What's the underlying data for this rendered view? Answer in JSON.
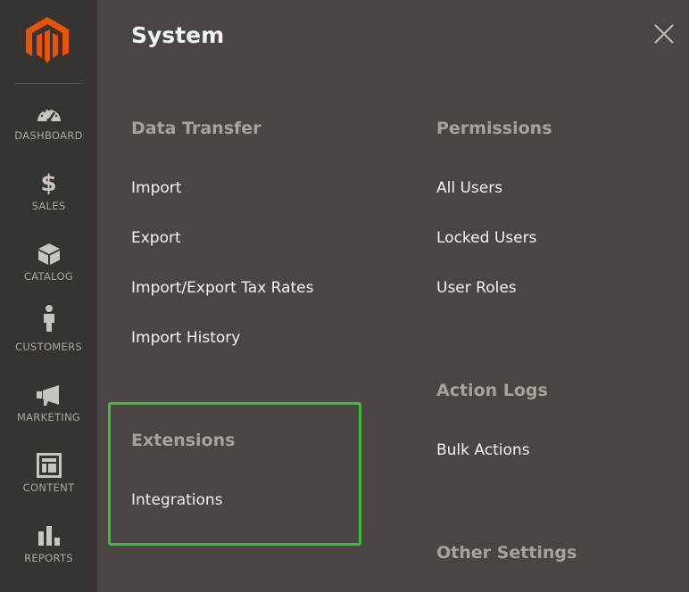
{
  "sidebar": {
    "logo": {
      "icon": "magento-logo-icon",
      "color": "#eb5202"
    },
    "items": [
      {
        "label": "DASHBOARD",
        "icon": "speedometer-icon"
      },
      {
        "label": "SALES",
        "icon": "dollar-icon"
      },
      {
        "label": "CATALOG",
        "icon": "box-icon"
      },
      {
        "label": "CUSTOMERS",
        "icon": "person-icon"
      },
      {
        "label": "MARKETING",
        "icon": "megaphone-icon"
      },
      {
        "label": "CONTENT",
        "icon": "layout-icon"
      },
      {
        "label": "REPORTS",
        "icon": "bar-chart-icon"
      }
    ]
  },
  "panel": {
    "title": "System",
    "close_icon": "close-icon",
    "groups": {
      "data_transfer": {
        "title": "Data Transfer",
        "links": [
          "Import",
          "Export",
          "Import/Export Tax Rates",
          "Import History"
        ]
      },
      "extensions": {
        "title": "Extensions",
        "links": [
          "Integrations"
        ],
        "highlight_color": "#3dbd3a"
      },
      "permissions": {
        "title": "Permissions",
        "links": [
          "All Users",
          "Locked Users",
          "User Roles"
        ]
      },
      "action_logs": {
        "title": "Action Logs",
        "links": [
          "Bulk Actions"
        ]
      },
      "other_settings": {
        "title": "Other Settings"
      }
    }
  },
  "colors": {
    "sidebar_bg": "#373330",
    "panel_bg": "#4a4542",
    "group_title": "#a8a29b",
    "link": "#f4f4f4",
    "accent": "#eb5202"
  }
}
